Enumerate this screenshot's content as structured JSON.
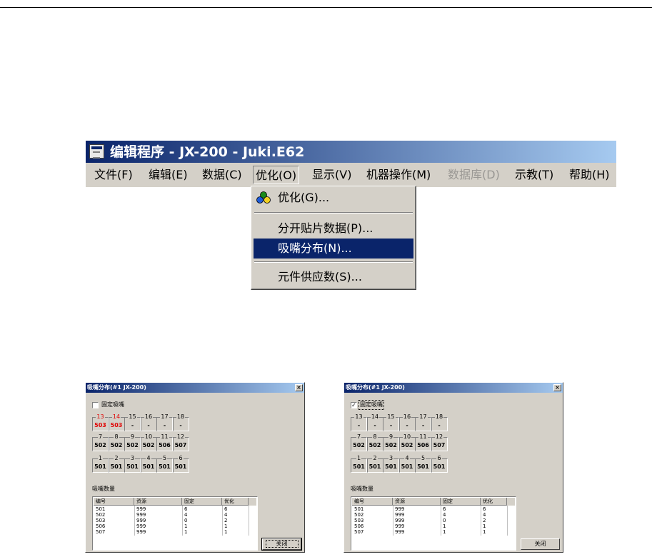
{
  "window": {
    "title": "编辑程序 - JX-200 - Juki.E62",
    "menus": [
      {
        "label": "文件(F)",
        "disabled": false
      },
      {
        "label": "编辑(E)",
        "disabled": false
      },
      {
        "label": "数据(C)",
        "disabled": false
      },
      {
        "label": "优化(O)",
        "disabled": false
      },
      {
        "label": "显示(V)",
        "disabled": false
      },
      {
        "label": "机器操作(M)",
        "disabled": false
      },
      {
        "label": "数据库(D)",
        "disabled": true
      },
      {
        "label": "示教(T)",
        "disabled": false
      },
      {
        "label": "帮助(H)",
        "disabled": false
      }
    ]
  },
  "dropdown": {
    "items": [
      {
        "label": "优化(G)...",
        "icon": "optimize-icon"
      },
      {
        "label": "分开贴片数据(P)..."
      },
      {
        "label": "吸嘴分布(N)...",
        "selected": true
      },
      {
        "label": "元件供应数(S)..."
      }
    ]
  },
  "dialogs": [
    {
      "title": "吸嘴分布(#1 JX-200)",
      "close_glyph": "×",
      "checkbox_label": "固定吸嘴",
      "checkbox_checked": false,
      "checkbox_glyph": "",
      "slot_rows": [
        [
          {
            "num": "13",
            "val": "503",
            "red": true
          },
          {
            "num": "14",
            "val": "503",
            "red": true
          },
          {
            "num": "15",
            "val": "-"
          },
          {
            "num": "16",
            "val": "-"
          },
          {
            "num": "17",
            "val": "-"
          },
          {
            "num": "18",
            "val": "-"
          }
        ],
        [
          {
            "num": "7",
            "val": "502"
          },
          {
            "num": "8",
            "val": "502"
          },
          {
            "num": "9",
            "val": "502"
          },
          {
            "num": "10",
            "val": "502"
          },
          {
            "num": "11",
            "val": "506"
          },
          {
            "num": "12",
            "val": "507"
          }
        ],
        [
          {
            "num": "1",
            "val": "501"
          },
          {
            "num": "2",
            "val": "501"
          },
          {
            "num": "3",
            "val": "501"
          },
          {
            "num": "4",
            "val": "501"
          },
          {
            "num": "5",
            "val": "501"
          },
          {
            "num": "6",
            "val": "501"
          }
        ]
      ],
      "count_label": "吸嘴数量",
      "columns": [
        "编号",
        "资源",
        "固定",
        "优化"
      ],
      "rows": [
        [
          "501",
          "999",
          "6",
          "6"
        ],
        [
          "502",
          "999",
          "4",
          "4"
        ],
        [
          "503",
          "999",
          "0",
          "2"
        ],
        [
          "506",
          "999",
          "1",
          "1"
        ],
        [
          "507",
          "999",
          "1",
          "1"
        ]
      ],
      "close_label": "关闭",
      "close_focused": true
    },
    {
      "title": "吸嘴分布(#1 JX-200)",
      "close_glyph": "×",
      "checkbox_label": "固定吸嘴",
      "checkbox_checked": true,
      "checkbox_glyph": "✓",
      "slot_rows": [
        [
          {
            "num": "13",
            "val": "-"
          },
          {
            "num": "14",
            "val": "-"
          },
          {
            "num": "15",
            "val": "-"
          },
          {
            "num": "16",
            "val": "-"
          },
          {
            "num": "17",
            "val": "-"
          },
          {
            "num": "18",
            "val": "-"
          }
        ],
        [
          {
            "num": "7",
            "val": "502"
          },
          {
            "num": "8",
            "val": "502"
          },
          {
            "num": "9",
            "val": "502"
          },
          {
            "num": "10",
            "val": "502"
          },
          {
            "num": "11",
            "val": "506"
          },
          {
            "num": "12",
            "val": "507"
          }
        ],
        [
          {
            "num": "1",
            "val": "501"
          },
          {
            "num": "2",
            "val": "501"
          },
          {
            "num": "3",
            "val": "501"
          },
          {
            "num": "4",
            "val": "501"
          },
          {
            "num": "5",
            "val": "501"
          },
          {
            "num": "6",
            "val": "501"
          }
        ]
      ],
      "count_label": "吸嘴数量",
      "columns": [
        "编号",
        "资源",
        "固定",
        "优化"
      ],
      "rows": [
        [
          "501",
          "999",
          "6",
          "6"
        ],
        [
          "502",
          "999",
          "4",
          "4"
        ],
        [
          "503",
          "999",
          "0",
          "2"
        ],
        [
          "506",
          "999",
          "1",
          "1"
        ],
        [
          "507",
          "999",
          "1",
          "1"
        ]
      ],
      "close_label": "关闭",
      "close_focused": false
    }
  ]
}
